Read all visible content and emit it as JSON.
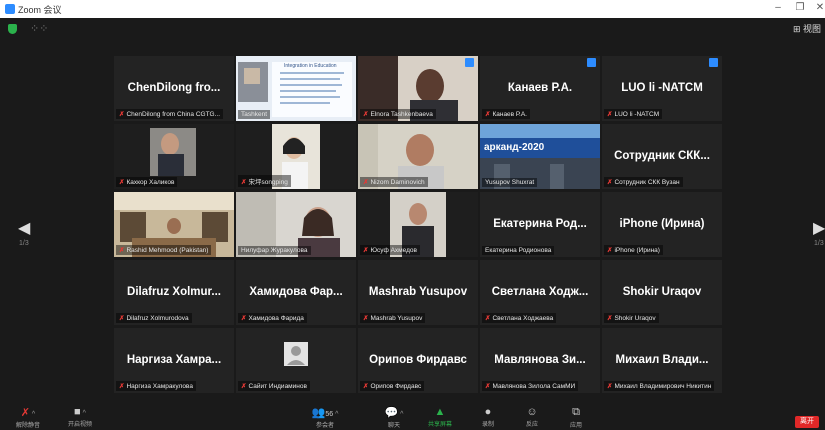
{
  "window": {
    "title": "Zoom 会议"
  },
  "topbar": {
    "view_label": "⊞ 视图",
    "grid_glyph": "⁘⁘"
  },
  "pager": {
    "left": "1/3",
    "right": "1/3"
  },
  "tiles": [
    {
      "big": "ChenDilong fro...",
      "label": "ChenDilong from China CGTG..."
    },
    {
      "big": "",
      "label": "Tashkent",
      "slide_title": "Integration in Education"
    },
    {
      "big": "",
      "label": "Elnora Tashkenbaeva"
    },
    {
      "big": "Канаев Р.А.",
      "label": "Канаев Р.А."
    },
    {
      "big": "LUO li -NATCM",
      "label": "LUO li -NATCM"
    },
    {
      "big": "",
      "label": "Кахкор Халиков"
    },
    {
      "big": "",
      "label": "宋坪songping"
    },
    {
      "big": "",
      "label": "Nizom Daminovich"
    },
    {
      "big": "",
      "label": "Yusupov Shuxrat",
      "banner": "арканд-2020"
    },
    {
      "big": "Сотрудник СКК...",
      "label": "Сотрудник СКК Вузан"
    },
    {
      "big": "",
      "label": "Rashid Mehmood (Pakistan)"
    },
    {
      "big": "",
      "label": "Нилуфар Журакулова"
    },
    {
      "big": "",
      "label": "Юсуф Ахмедов"
    },
    {
      "big": "Екатерина Род...",
      "label": "Екатерина Родионова"
    },
    {
      "big": "iPhone (Ирина)",
      "label": "iPhone (Ирина)"
    },
    {
      "big": "Dilafruz Xolmur...",
      "label": "Dilafruz Xolmurodova"
    },
    {
      "big": "Хамидова Фар...",
      "label": "Хамидова Фарида"
    },
    {
      "big": "Mashrab Yusupov",
      "label": "Mashrab Yusupov"
    },
    {
      "big": "Светлана Ходж...",
      "label": "Светлана Ходжаева"
    },
    {
      "big": "Shokir Uraqov",
      "label": "Shokir Uraqov"
    },
    {
      "big": "Наргиза Хамра...",
      "label": "Наргиза Хамракулова"
    },
    {
      "big": "",
      "label": "Сайит Индиаминов"
    },
    {
      "big": "Орипов Фирдавс",
      "label": "Орипов Фирдавс"
    },
    {
      "big": "Мавлянова Зи...",
      "label": "Мавлянова Зилола СамМИ"
    },
    {
      "big": "Михаил Влади...",
      "label": "Михаил Владимирович Никитин"
    }
  ],
  "toolbar": {
    "mute": "解除静音",
    "video": "开启视频",
    "participants": "参会者",
    "participants_count": "56",
    "chat": "聊天",
    "share": "共享屏幕",
    "record": "录制",
    "reactions": "反应",
    "apps": "应用",
    "end": "离开"
  },
  "colors": {
    "active_border": "#b5e61d",
    "blue_badge": "#2d8cff",
    "end": "#e02828"
  }
}
